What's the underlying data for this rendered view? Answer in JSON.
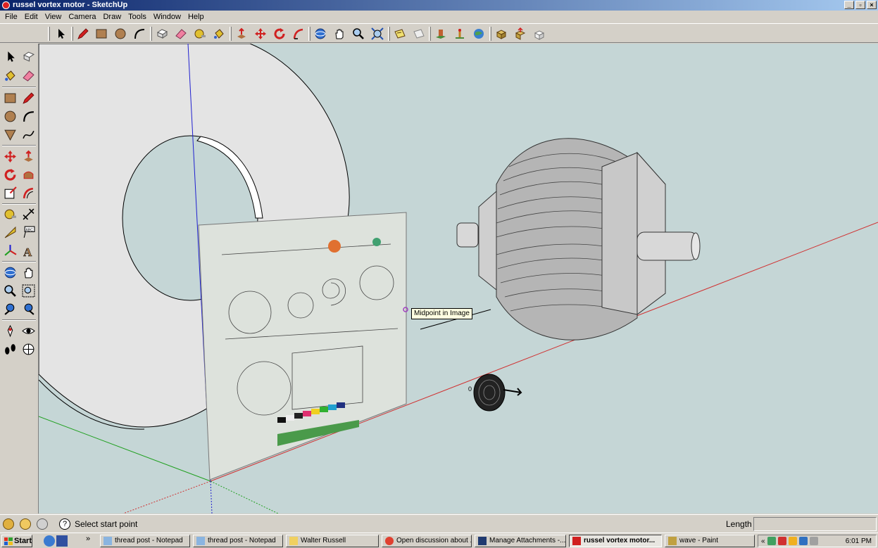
{
  "window": {
    "title": "russel vortex motor - SketchUp",
    "controls": [
      "_",
      "▫",
      "×"
    ]
  },
  "menu": [
    "File",
    "Edit",
    "View",
    "Camera",
    "Draw",
    "Tools",
    "Window",
    "Help"
  ],
  "viewport": {
    "tooltip": "Midpoint in Image",
    "origin_label": "0"
  },
  "status": {
    "message": "Select start point",
    "length_label": "Length",
    "length_value": ""
  },
  "taskbar": {
    "start_label": "Start",
    "tasks": [
      {
        "label": "thread post - Notepad",
        "active": false
      },
      {
        "label": "thread post - Notepad",
        "active": false
      },
      {
        "label": "Walter Russell",
        "active": false
      },
      {
        "label": "Open discussion about ...",
        "active": false
      },
      {
        "label": "Manage Attachments -...",
        "active": false
      },
      {
        "label": "russel vortex motor...",
        "active": true
      },
      {
        "label": "wave - Paint",
        "active": false
      }
    ],
    "clock": "6:01 PM"
  },
  "colors": {
    "viewport_bg": "#c5d6d6",
    "axis_red": "#d03030",
    "axis_green": "#20a020",
    "axis_blue": "#2020d0",
    "chrome": "#d4d0c8"
  },
  "icons": {
    "toolbar": [
      "select-icon",
      "pencil-icon",
      "rectangle-icon",
      "circle-icon",
      "arc-icon",
      "make-component-icon",
      "eraser-icon",
      "tape-measure-icon",
      "paint-bucket-icon",
      "push-pull-icon",
      "move-icon",
      "rotate-icon",
      "follow-me-icon",
      "orbit-icon",
      "pan-icon",
      "zoom-icon",
      "zoom-extents-icon",
      "previous-view-icon",
      "next-view-icon",
      "add-location-icon",
      "toggle-terrain-icon",
      "preview-google-earth-icon",
      "get-models-icon",
      "share-model-icon",
      "share-component-icon"
    ]
  }
}
